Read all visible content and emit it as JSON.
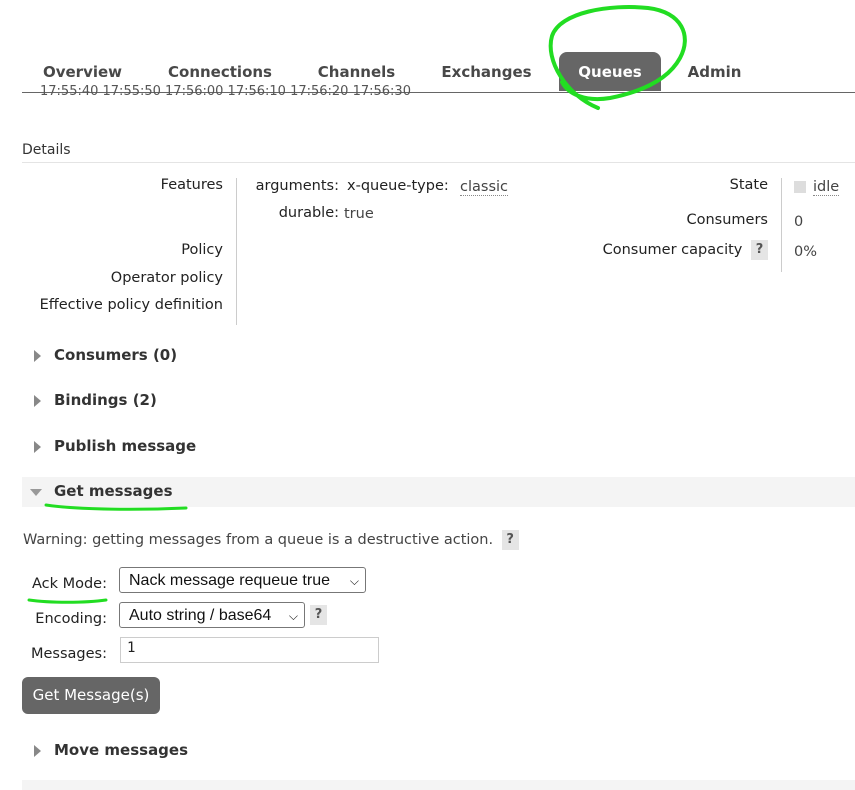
{
  "tabs": [
    {
      "label": "Overview"
    },
    {
      "label": "Connections"
    },
    {
      "label": "Channels"
    },
    {
      "label": "Exchanges"
    },
    {
      "label": "Queues",
      "active": true
    },
    {
      "label": "Admin"
    }
  ],
  "chart_axis_text": "17:55:40 17:55:50 17:56:00 17:56:10 17:56:20 17:56:30",
  "details": {
    "heading": "Details",
    "features_label": "Features",
    "arguments_key": "arguments:",
    "queue_type_key": "x-queue-type:",
    "queue_type_value": "classic",
    "durable_key": "durable:",
    "durable_value": "true",
    "policy_label": "Policy",
    "operator_policy_label": "Operator policy",
    "effective_policy_label": "Effective policy definition",
    "state_label": "State",
    "state_value": "idle",
    "consumers_label": "Consumers",
    "consumers_value": "0",
    "consumer_capacity_label": "Consumer capacity",
    "consumer_capacity_value": "0%",
    "help_glyph": "?"
  },
  "sections": {
    "consumers": "Consumers (0)",
    "bindings": "Bindings (2)",
    "publish": "Publish message",
    "get": "Get messages",
    "move": "Move messages"
  },
  "get_messages": {
    "warning": "Warning: getting messages from a queue is a destructive action.",
    "ack_mode_label": "Ack Mode:",
    "ack_mode_value": "Nack message requeue true",
    "encoding_label": "Encoding:",
    "encoding_value": "Auto string / base64",
    "messages_label": "Messages:",
    "messages_value": "1",
    "button_label": "Get Message(s)"
  },
  "colors": {
    "tab_active_bg": "#666666",
    "annotation_green": "#22dd22",
    "button_bg": "#666666"
  }
}
